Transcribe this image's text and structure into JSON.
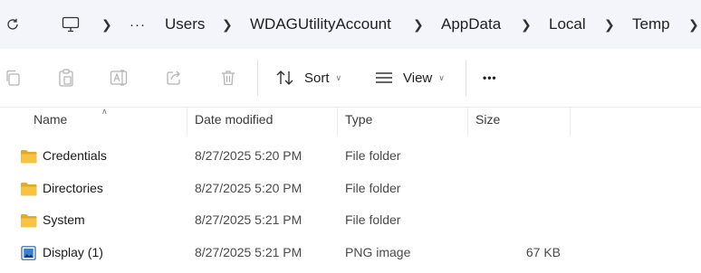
{
  "address_bar": {
    "refresh_icon": "refresh-icon",
    "ellipsis": "···",
    "crumbs": [
      "Users",
      "WDAGUtilityAccount",
      "AppData",
      "Local",
      "Temp"
    ]
  },
  "toolbar": {
    "sort_label": "Sort",
    "view_label": "View",
    "more_label": "•••"
  },
  "columns": {
    "name": "Name",
    "date": "Date modified",
    "type": "Type",
    "size": "Size"
  },
  "files": [
    {
      "name": "Credentials",
      "date": "8/27/2025 5:20 PM",
      "type": "File folder",
      "size": "",
      "icon": "folder-icon"
    },
    {
      "name": "Directories",
      "date": "8/27/2025 5:20 PM",
      "type": "File folder",
      "size": "",
      "icon": "folder-icon"
    },
    {
      "name": "System",
      "date": "8/27/2025 5:21 PM",
      "type": "File folder",
      "size": "",
      "icon": "folder-icon"
    },
    {
      "name": "Display (1)",
      "date": "8/27/2025 5:21 PM",
      "type": "PNG image",
      "size": "67 KB",
      "icon": "png-image-icon"
    }
  ],
  "colors": {
    "address_bg": "#f3f5fa",
    "folder": "#f6c343",
    "folder_dark": "#e4a92b"
  }
}
